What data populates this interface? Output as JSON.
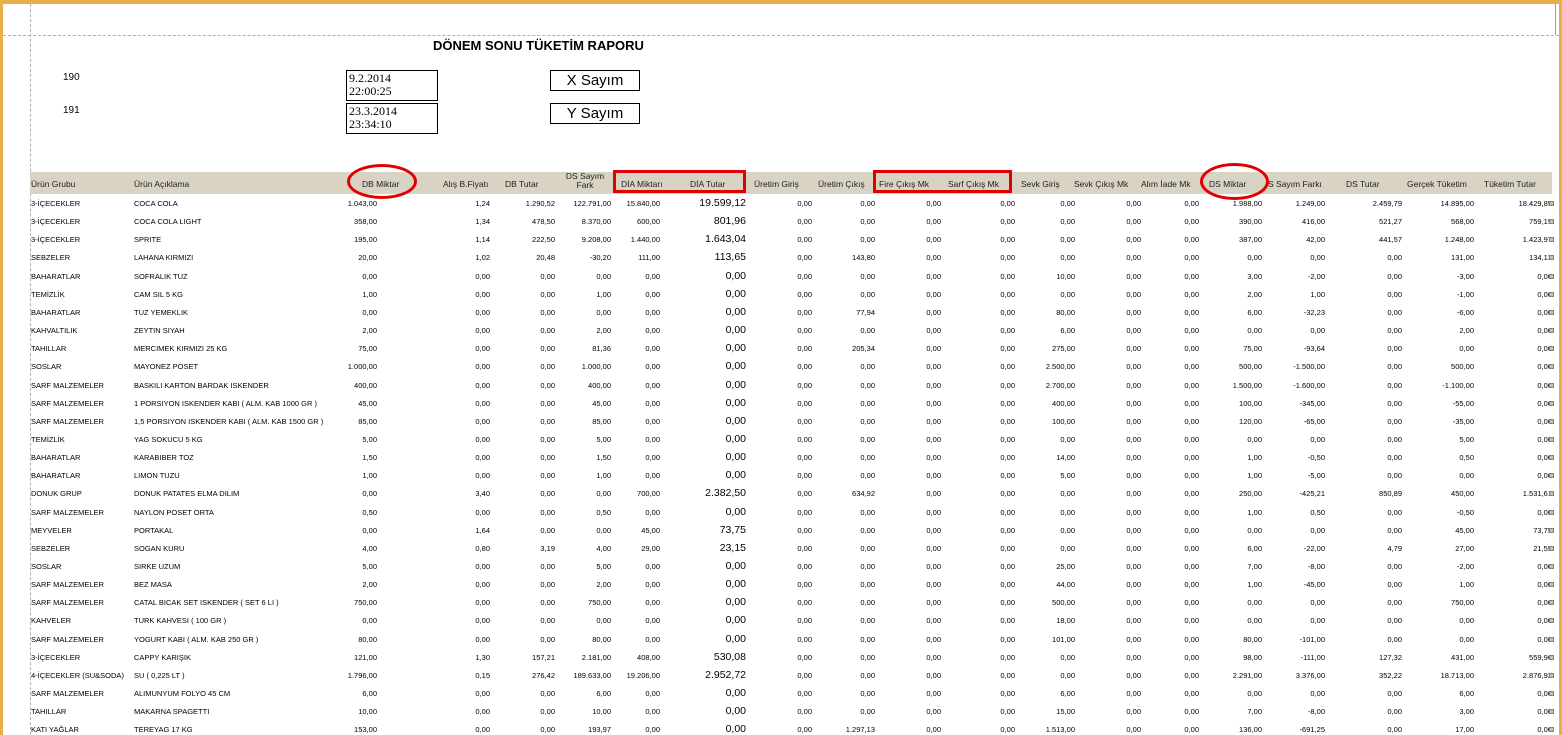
{
  "report": {
    "title": "DÖNEM SONU TÜKETİM RAPORU",
    "period_start_number": "190",
    "period_end_number": "191",
    "start_date": "9.2.2014",
    "start_time": "22:00:25",
    "end_date": "23.3.2014",
    "end_time": "23:34:10",
    "x_button": "X Sayım",
    "y_button": "Y Sayım"
  },
  "columns": [
    "Ürün Grubu",
    "Ürün Açıklama",
    "DB Miktar",
    "Alış B.Fiyatı",
    "DB Tutar",
    "DS Sayım Fark",
    "DİA Miktarı",
    "DİA Tutar",
    "Üretim Giriş",
    "Üretim Çıkış",
    "Fire Çıkış Mk",
    "Sarf Çıkış Mk",
    "Sevk Giriş",
    "Sevk Çıkış Mk",
    "Alım İade Mk",
    "DS Miktar",
    "S Sayım Farkı",
    "DS Tutar",
    "Gerçek Tüketim",
    "Tüketim Tutar"
  ],
  "rows": [
    [
      "3-İÇECEKLER",
      "COCA COLA",
      "1.043,00",
      "1,24",
      "1.290,52",
      "122.791,00",
      "15.840,00",
      "19.599,12",
      "0,00",
      "0,00",
      "0,00",
      "0,00",
      "0,00",
      "0,00",
      "0,00",
      "1.988,00",
      "1.249,00",
      "2.459,79",
      "14.895,00",
      "18.429,85"
    ],
    [
      "3-İÇECEKLER",
      "COCA COLA LIGHT",
      "358,00",
      "1,34",
      "478,50",
      "8.370,00",
      "600,00",
      "801,96",
      "0,00",
      "0,00",
      "0,00",
      "0,00",
      "0,00",
      "0,00",
      "0,00",
      "390,00",
      "416,00",
      "521,27",
      "568,00",
      "759,19"
    ],
    [
      "3-İÇECEKLER",
      "SPRITE",
      "195,00",
      "1,14",
      "222,50",
      "9.208,00",
      "1.440,00",
      "1.643,04",
      "0,00",
      "0,00",
      "0,00",
      "0,00",
      "0,00",
      "0,00",
      "0,00",
      "387,00",
      "42,00",
      "441,57",
      "1.248,00",
      "1.423,97"
    ],
    [
      "SEBZELER",
      "LAHANA KIRMIZI",
      "20,00",
      "1,02",
      "20,48",
      "-30,20",
      "111,00",
      "113,65",
      "0,00",
      "143,80",
      "0,00",
      "0,00",
      "0,00",
      "0,00",
      "0,00",
      "0,00",
      "0,00",
      "0,00",
      "131,00",
      "134,13"
    ],
    [
      "BAHARATLAR",
      "SOFRALIK TUZ",
      "0,00",
      "0,00",
      "0,00",
      "0,00",
      "0,00",
      "0,00",
      "0,00",
      "0,00",
      "0,00",
      "0,00",
      "10,00",
      "0,00",
      "0,00",
      "3,00",
      "-2,00",
      "0,00",
      "-3,00",
      "0,00"
    ],
    [
      "TEMİZLİK",
      "CAM SIL 5 KG",
      "1,00",
      "0,00",
      "0,00",
      "1,00",
      "0,00",
      "0,00",
      "0,00",
      "0,00",
      "0,00",
      "0,00",
      "0,00",
      "0,00",
      "0,00",
      "2,00",
      "1,00",
      "0,00",
      "-1,00",
      "0,00"
    ],
    [
      "BAHARATLAR",
      "TUZ YEMEKLIK",
      "0,00",
      "0,00",
      "0,00",
      "0,00",
      "0,00",
      "0,00",
      "0,00",
      "77,94",
      "0,00",
      "0,00",
      "80,00",
      "0,00",
      "0,00",
      "6,00",
      "-32,23",
      "0,00",
      "-6,00",
      "0,00"
    ],
    [
      "KAHVALTILIK",
      "ZEYTIN SIYAH",
      "2,00",
      "0,00",
      "0,00",
      "2,00",
      "0,00",
      "0,00",
      "0,00",
      "0,00",
      "0,00",
      "0,00",
      "6,00",
      "0,00",
      "0,00",
      "0,00",
      "0,00",
      "0,00",
      "2,00",
      "0,00"
    ],
    [
      "TAHILLAR",
      "MERCIMEK KIRMIZI 25 KG",
      "75,00",
      "0,00",
      "0,00",
      "81,36",
      "0,00",
      "0,00",
      "0,00",
      "205,34",
      "0,00",
      "0,00",
      "275,00",
      "0,00",
      "0,00",
      "75,00",
      "-93,64",
      "0,00",
      "0,00",
      "0,00"
    ],
    [
      "SOSLAR",
      "MAYONEZ POSET",
      "1.000,00",
      "0,00",
      "0,00",
      "1.000,00",
      "0,00",
      "0,00",
      "0,00",
      "0,00",
      "0,00",
      "0,00",
      "2.500,00",
      "0,00",
      "0,00",
      "500,00",
      "-1.500,00",
      "0,00",
      "500,00",
      "0,00"
    ],
    [
      "SARF MALZEMELER",
      "BASKILI KARTON BARDAK ISKENDER",
      "400,00",
      "0,00",
      "0,00",
      "400,00",
      "0,00",
      "0,00",
      "0,00",
      "0,00",
      "0,00",
      "0,00",
      "2.700,00",
      "0,00",
      "0,00",
      "1.500,00",
      "-1.600,00",
      "0,00",
      "-1.100,00",
      "0,00"
    ],
    [
      "SARF MALZEMELER",
      "1 PORSIYON ISKENDER KABI ( ALM. KAB 1000 GR )",
      "45,00",
      "0,00",
      "0,00",
      "45,00",
      "0,00",
      "0,00",
      "0,00",
      "0,00",
      "0,00",
      "0,00",
      "400,00",
      "0,00",
      "0,00",
      "100,00",
      "-345,00",
      "0,00",
      "-55,00",
      "0,00"
    ],
    [
      "SARF MALZEMELER",
      "1,5 PORSIYON ISKENDER KABI ( ALM. KAB 1500 GR )",
      "85,00",
      "0,00",
      "0,00",
      "85,00",
      "0,00",
      "0,00",
      "0,00",
      "0,00",
      "0,00",
      "0,00",
      "100,00",
      "0,00",
      "0,00",
      "120,00",
      "-65,00",
      "0,00",
      "-35,00",
      "0,00"
    ],
    [
      "TEMİZLİK",
      "YAG SOKUCU 5 KG",
      "5,00",
      "0,00",
      "0,00",
      "5,00",
      "0,00",
      "0,00",
      "0,00",
      "0,00",
      "0,00",
      "0,00",
      "0,00",
      "0,00",
      "0,00",
      "0,00",
      "0,00",
      "0,00",
      "5,00",
      "0,00"
    ],
    [
      "BAHARATLAR",
      "KARABIBER TOZ",
      "1,50",
      "0,00",
      "0,00",
      "1,50",
      "0,00",
      "0,00",
      "0,00",
      "0,00",
      "0,00",
      "0,00",
      "14,00",
      "0,00",
      "0,00",
      "1,00",
      "-0,50",
      "0,00",
      "0,50",
      "0,00"
    ],
    [
      "BAHARATLAR",
      "LIMON TUZU",
      "1,00",
      "0,00",
      "0,00",
      "1,00",
      "0,00",
      "0,00",
      "0,00",
      "0,00",
      "0,00",
      "0,00",
      "5,00",
      "0,00",
      "0,00",
      "1,00",
      "-5,00",
      "0,00",
      "0,00",
      "0,00"
    ],
    [
      "DONUK GRUP",
      "DONUK PATATES ELMA DILIM",
      "0,00",
      "3,40",
      "0,00",
      "0,00",
      "700,00",
      "2.382,50",
      "0,00",
      "634,92",
      "0,00",
      "0,00",
      "0,00",
      "0,00",
      "0,00",
      "250,00",
      "-425,21",
      "850,89",
      "450,00",
      "1.531,61"
    ],
    [
      "SARF MALZEMELER",
      "NAYLON POSET ORTA",
      "0,50",
      "0,00",
      "0,00",
      "0,50",
      "0,00",
      "0,00",
      "0,00",
      "0,00",
      "0,00",
      "0,00",
      "0,00",
      "0,00",
      "0,00",
      "1,00",
      "0,50",
      "0,00",
      "-0,50",
      "0,00"
    ],
    [
      "MEYVELER",
      "PORTAKAL",
      "0,00",
      "1,64",
      "0,00",
      "0,00",
      "45,00",
      "73,75",
      "0,00",
      "0,00",
      "0,00",
      "0,00",
      "0,00",
      "0,00",
      "0,00",
      "0,00",
      "0,00",
      "0,00",
      "45,00",
      "73,75"
    ],
    [
      "SEBZELER",
      "SOGAN KURU",
      "4,00",
      "0,80",
      "3,19",
      "4,00",
      "29,00",
      "23,15",
      "0,00",
      "0,00",
      "0,00",
      "0,00",
      "0,00",
      "0,00",
      "0,00",
      "6,00",
      "-22,00",
      "4,79",
      "27,00",
      "21,55"
    ],
    [
      "SOSLAR",
      "SIRKE UZUM",
      "5,00",
      "0,00",
      "0,00",
      "5,00",
      "0,00",
      "0,00",
      "0,00",
      "0,00",
      "0,00",
      "0,00",
      "25,00",
      "0,00",
      "0,00",
      "7,00",
      "-8,00",
      "0,00",
      "-2,00",
      "0,00"
    ],
    [
      "SARF MALZEMELER",
      "BEZ MASA",
      "2,00",
      "0,00",
      "0,00",
      "2,00",
      "0,00",
      "0,00",
      "0,00",
      "0,00",
      "0,00",
      "0,00",
      "44,00",
      "0,00",
      "0,00",
      "1,00",
      "-45,00",
      "0,00",
      "1,00",
      "0,00"
    ],
    [
      "SARF MALZEMELER",
      "CATAL BICAK SET ISKENDER ( SET 6 LI )",
      "750,00",
      "0,00",
      "0,00",
      "750,00",
      "0,00",
      "0,00",
      "0,00",
      "0,00",
      "0,00",
      "0,00",
      "500,00",
      "0,00",
      "0,00",
      "0,00",
      "0,00",
      "0,00",
      "750,00",
      "0,00"
    ],
    [
      "KAHVELER",
      "TURK KAHVESI ( 100 GR )",
      "0,00",
      "0,00",
      "0,00",
      "0,00",
      "0,00",
      "0,00",
      "0,00",
      "0,00",
      "0,00",
      "0,00",
      "18,00",
      "0,00",
      "0,00",
      "0,00",
      "0,00",
      "0,00",
      "0,00",
      "0,00"
    ],
    [
      "SARF MALZEMELER",
      "YOGURT KABI ( ALM. KAB 250 GR )",
      "80,00",
      "0,00",
      "0,00",
      "80,00",
      "0,00",
      "0,00",
      "0,00",
      "0,00",
      "0,00",
      "0,00",
      "101,00",
      "0,00",
      "0,00",
      "80,00",
      "-101,00",
      "0,00",
      "0,00",
      "0,00"
    ],
    [
      "3-İÇECEKLER",
      "CAPPY KARIŞIK",
      "121,00",
      "1,30",
      "157,21",
      "2.181,00",
      "408,00",
      "530,08",
      "0,00",
      "0,00",
      "0,00",
      "0,00",
      "0,00",
      "0,00",
      "0,00",
      "98,00",
      "-111,00",
      "127,32",
      "431,00",
      "559,96"
    ],
    [
      "4-İÇECEKLER (SU&SODA)",
      "SU ( 0,225 LT )",
      "1.796,00",
      "0,15",
      "276,42",
      "189.633,00",
      "19.206,00",
      "2.952,72",
      "0,00",
      "0,00",
      "0,00",
      "0,00",
      "0,00",
      "0,00",
      "0,00",
      "2.291,00",
      "3.376,00",
      "352,22",
      "18.713,00",
      "2.876,92"
    ],
    [
      "SARF MALZEMELER",
      "ALIMUNYUM FOLYO 45 CM",
      "6,00",
      "0,00",
      "0,00",
      "6,00",
      "0,00",
      "0,00",
      "0,00",
      "0,00",
      "0,00",
      "0,00",
      "6,00",
      "0,00",
      "0,00",
      "0,00",
      "0,00",
      "0,00",
      "6,00",
      "0,00"
    ],
    [
      "TAHILLAR",
      "MAKARNA SPAGETTI",
      "10,00",
      "0,00",
      "0,00",
      "10,00",
      "0,00",
      "0,00",
      "0,00",
      "0,00",
      "0,00",
      "0,00",
      "15,00",
      "0,00",
      "0,00",
      "7,00",
      "-8,00",
      "0,00",
      "3,00",
      "0,00"
    ],
    [
      "KATI YAĞLAR",
      "TEREYAG 17 KG",
      "153,00",
      "0,00",
      "0,00",
      "193,97",
      "0,00",
      "0,00",
      "0,00",
      "1.297,13",
      "0,00",
      "0,00",
      "1.513,00",
      "0,00",
      "0,00",
      "136,00",
      "-691,25",
      "0,00",
      "17,00",
      "0,00"
    ]
  ]
}
